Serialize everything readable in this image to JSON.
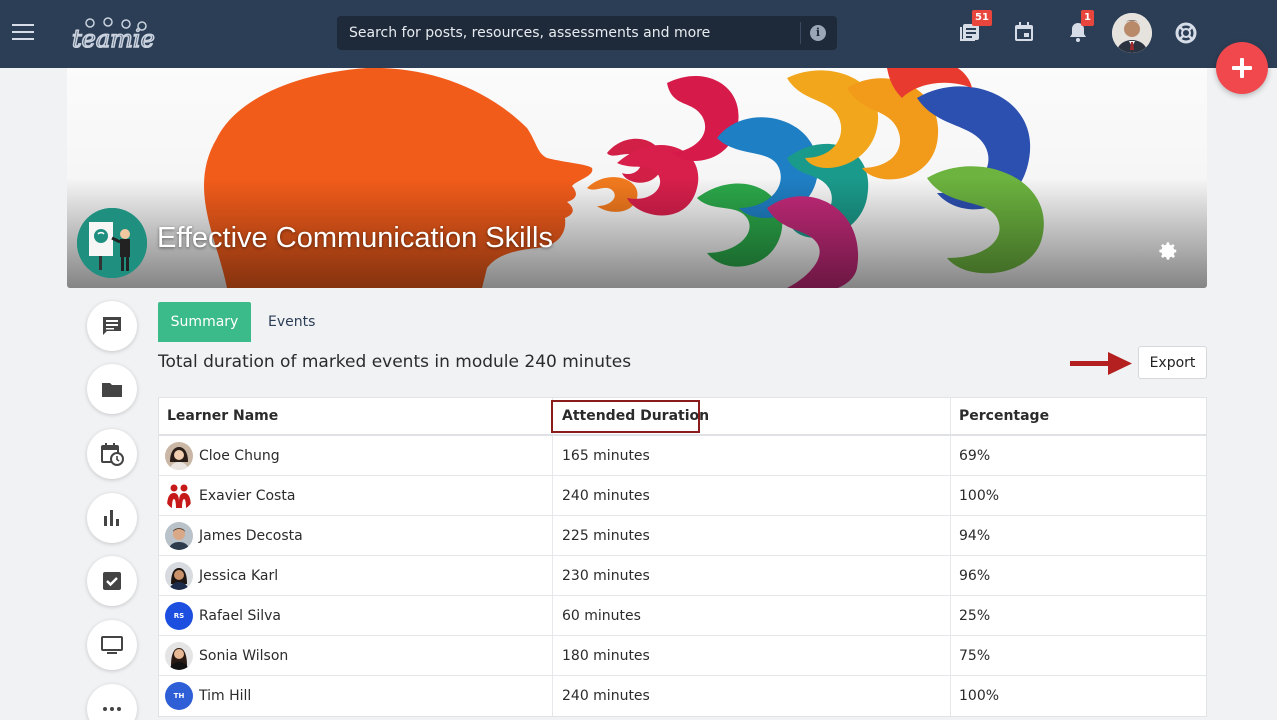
{
  "header": {
    "search_placeholder": "Search for posts, resources, assessments and more",
    "notifications_badge": "51",
    "alerts_badge": "1",
    "icons": [
      "menu-icon",
      "teamie-logo",
      "info-icon",
      "newsfeed-icon",
      "calendar-icon",
      "bell-icon",
      "avatar",
      "help-icon"
    ]
  },
  "course": {
    "title": "Effective Communication Skills"
  },
  "tabs": [
    {
      "label": "Summary",
      "active": true
    },
    {
      "label": "Events",
      "active": false
    }
  ],
  "summary": {
    "total_text": "Total duration of marked events in module 240 minutes",
    "export_label": "Export"
  },
  "table": {
    "headers": [
      "Learner Name",
      "Attended Duration",
      "Percentage"
    ],
    "rows": [
      {
        "name": "Cloe Chung",
        "duration": "165 minutes",
        "percentage": "69%"
      },
      {
        "name": "Exavier Costa",
        "duration": "240 minutes",
        "percentage": "100%"
      },
      {
        "name": "James Decosta",
        "duration": "225 minutes",
        "percentage": "94%"
      },
      {
        "name": "Jessica Karl",
        "duration": "230 minutes",
        "percentage": "96%"
      },
      {
        "name": "Rafael Silva",
        "duration": "60 minutes",
        "percentage": "25%",
        "initials": "RS"
      },
      {
        "name": "Sonia Wilson",
        "duration": "180 minutes",
        "percentage": "75%"
      },
      {
        "name": "Tim Hill",
        "duration": "240 minutes",
        "percentage": "100%",
        "initials": "TH"
      }
    ]
  },
  "colors": {
    "topbar": "#2c3e56",
    "active_tab": "#3cbb8a",
    "fab": "#f0484d",
    "highlight_box": "#8a1c1c",
    "arrow": "#b3201f"
  }
}
